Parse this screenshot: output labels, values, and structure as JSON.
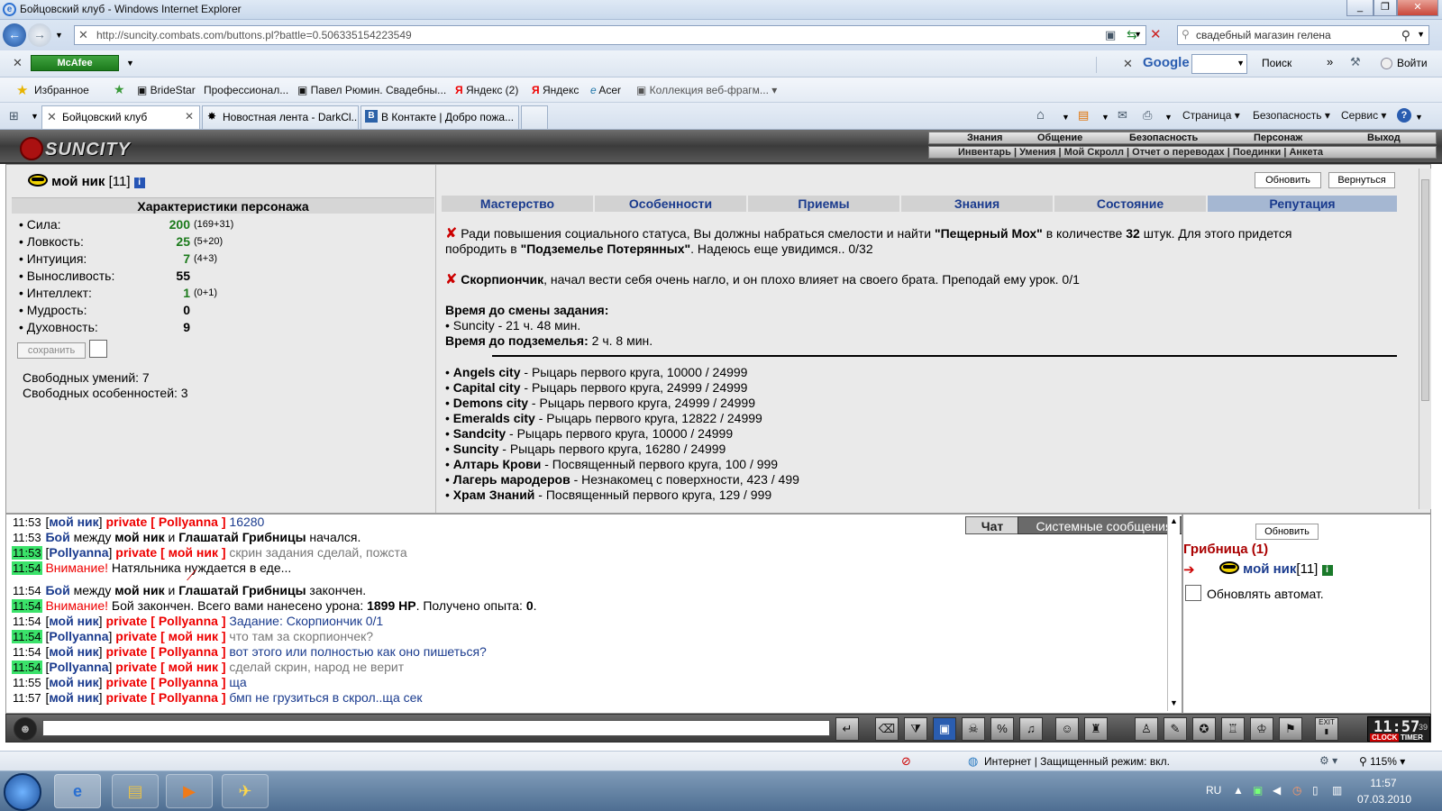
{
  "window": {
    "title": "Бойцовский клуб - Windows Internet Explorer"
  },
  "browser": {
    "address": "http://suncity.combats.com/buttons.pl?battle=0.506335154223549",
    "search_text": "свадебный магазин гелена",
    "mcafee": "McAfee",
    "google_label": "Google",
    "google_search": "Поиск",
    "google_login": "Войти",
    "favorites": [
      "Избранное",
      "BrideStar",
      "Профессионал...",
      "Павел Рюмин. Свадебны...",
      "Яндекс (2)",
      "Яндекс",
      "Acer",
      "Коллекция веб-фрагм..."
    ],
    "tabs": [
      "Бойцовский клуб",
      "Новостная лента - DarkCl...",
      "В Контакте | Добро пожа..."
    ],
    "commands": [
      "Страница",
      "Безопасность",
      "Сервис"
    ]
  },
  "game": {
    "logo": "SUNCITY",
    "main_menu": [
      "Знания",
      "Общение",
      "Безопасность",
      "Персонаж",
      "Выход"
    ],
    "sub_menu": "Инвентарь | Умения | Мой Скролл | Отчет о переводах | Поединки | Анкета"
  },
  "character": {
    "name": "мой ник",
    "level": "[11]",
    "stats_title": "Характеристики персонажа",
    "stats": [
      {
        "label": "• Сила:",
        "value": "200",
        "detail": "(169+31)",
        "green": true
      },
      {
        "label": "• Ловкость:",
        "value": "25",
        "detail": "(5+20)",
        "green": true
      },
      {
        "label": "• Интуиция:",
        "value": "7",
        "detail": "(4+3)",
        "green": true
      },
      {
        "label": "• Выносливость:",
        "value": "55",
        "detail": "",
        "green": false
      },
      {
        "label": "• Интеллект:",
        "value": "1",
        "detail": "(0+1)",
        "green": true
      },
      {
        "label": "• Мудрость:",
        "value": "0",
        "detail": "",
        "green": false
      },
      {
        "label": "• Духовность:",
        "value": "9",
        "detail": "",
        "green": false
      }
    ],
    "save_label": "сохранить",
    "free_skills": "Свободных умений: 7",
    "free_features": "Свободных особенностей: 3"
  },
  "panel": {
    "refresh": "Обновить",
    "back": "Вернуться",
    "tabs": [
      "Мастерство",
      "Особенности",
      "Приемы",
      "Знания",
      "Состояние",
      "Репутация"
    ],
    "selected_tab": "Репутация"
  },
  "quests": {
    "q1_a": "Ради повышения социального статуса, Вы должны набраться смелости и найти ",
    "q1_item": "\"Пещерный Мох\"",
    "q1_b": " в количестве ",
    "q1_count": "32",
    "q1_c": " штук. Для этого придется",
    "q1_d": "побродить в ",
    "q1_place": "\"Подземелье Потерянных\"",
    "q1_e": ". Надеюсь еще увидимся.. 0/32",
    "q2_name": "Скорпиончик",
    "q2_text": ", начал вести себя очень нагло, и он плохо влияет на своего брата. Преподай ему урок. 0/1",
    "timer_title": "Время до смены задания:",
    "timer_line": "• Suncity - 21 ч. 48 мин.",
    "dungeon_label": "Время до подземелья:",
    "dungeon_value": " 2 ч. 8 мин.",
    "reputation": [
      {
        "name": "Angels city",
        "text": " - Рыцарь первого круга, 10000 / 24999"
      },
      {
        "name": "Capital city",
        "text": " - Рыцарь первого круга, 24999 / 24999"
      },
      {
        "name": "Demons city",
        "text": " - Рыцарь первого круга, 24999 / 24999"
      },
      {
        "name": "Emeralds city",
        "text": " - Рыцарь первого круга, 12822 / 24999"
      },
      {
        "name": "Sandcity",
        "text": " - Рыцарь первого круга, 10000 / 24999"
      },
      {
        "name": "Suncity",
        "text": " - Рыцарь первого круга, 16280 / 24999"
      },
      {
        "name": "Алтарь Крови",
        "text": " - Посвященный первого круга, 100 / 999"
      },
      {
        "name": "Лагерь мародеров",
        "text": " - Незнакомец с поверхности, 423 / 499"
      },
      {
        "name": "Храм Знаний",
        "text": " - Посвященный первого круга, 129 / 999"
      }
    ]
  },
  "chat": {
    "tab_chat": "Чат",
    "tab_system": "Системные сообщения",
    "lines": [
      {
        "time": "11:53",
        "green": false,
        "kind": "priv",
        "from": "мой ник",
        "to": "Pollyanna",
        "text": "16280",
        "grey": false
      },
      {
        "time": "11:53",
        "green": false,
        "kind": "battle",
        "a": "Бой",
        "b": " между ",
        "c": " и ",
        "p1": "мой ник",
        "p2": "Глашатай Грибницы",
        "end": " начался."
      },
      {
        "time": "11:53",
        "green": true,
        "kind": "priv",
        "from": "Pollyanna",
        "to": "мой ник",
        "text": "скрин задания сделай, пожста",
        "grey": true
      },
      {
        "time": "11:54",
        "green": true,
        "kind": "warn",
        "label": "Внимание!",
        "text": " Натяльника нуждается в еде..."
      },
      {
        "time": "11:54",
        "green": false,
        "kind": "battle",
        "a": "Бой",
        "b": " между ",
        "c": " и ",
        "p1": "мой ник",
        "p2": "Глашатай Грибницы",
        "end": " закончен."
      },
      {
        "time": "11:54",
        "green": true,
        "kind": "warn2",
        "label": "Внимание!",
        "text": " Бой закончен. Всего вами нанесено урона: ",
        "dmg": "1899 HP",
        "text2": ". Получено опыта: ",
        "exp": "0",
        "text3": "."
      },
      {
        "time": "11:54",
        "green": false,
        "kind": "priv",
        "from": "мой ник",
        "to": "Pollyanna",
        "text": "Задание: Скорпиончик 0/1",
        "grey": false
      },
      {
        "time": "11:54",
        "green": true,
        "kind": "priv",
        "from": "Pollyanna",
        "to": "мой ник",
        "text": "что там за скорпиончек?",
        "grey": true
      },
      {
        "time": "11:54",
        "green": false,
        "kind": "priv",
        "from": "мой ник",
        "to": "Pollyanna",
        "text": "вот этого или полностью как оно пишеться?",
        "grey": false
      },
      {
        "time": "11:54",
        "green": true,
        "kind": "priv",
        "from": "Pollyanna",
        "to": "мой ник",
        "text": "сделай скрин, народ не верит",
        "grey": true
      },
      {
        "time": "11:55",
        "green": false,
        "kind": "priv",
        "from": "мой ник",
        "to": "Pollyanna",
        "text": "ща",
        "grey": false
      },
      {
        "time": "11:57",
        "green": false,
        "kind": "priv",
        "from": "мой ник",
        "to": "Pollyanna",
        "text": "бмп не грузиться в скрол..ща сек",
        "grey": false
      }
    ],
    "private_word": "private"
  },
  "players": {
    "refresh": "Обновить",
    "location": "Грибница (1)",
    "name": "мой ник",
    "level": "[11]",
    "auto": "Обновлять автомат."
  },
  "clock": {
    "time": "11:57",
    "seconds": "39",
    "label1": "CLOCK",
    "label2": "TIMER",
    "exit": "EXIT"
  },
  "status": {
    "zone": "Интернет | Защищенный режим: вкл.",
    "zoom": "115%"
  },
  "taskbar": {
    "lang": "RU",
    "time": "11:57",
    "date": "07.03.2010"
  }
}
